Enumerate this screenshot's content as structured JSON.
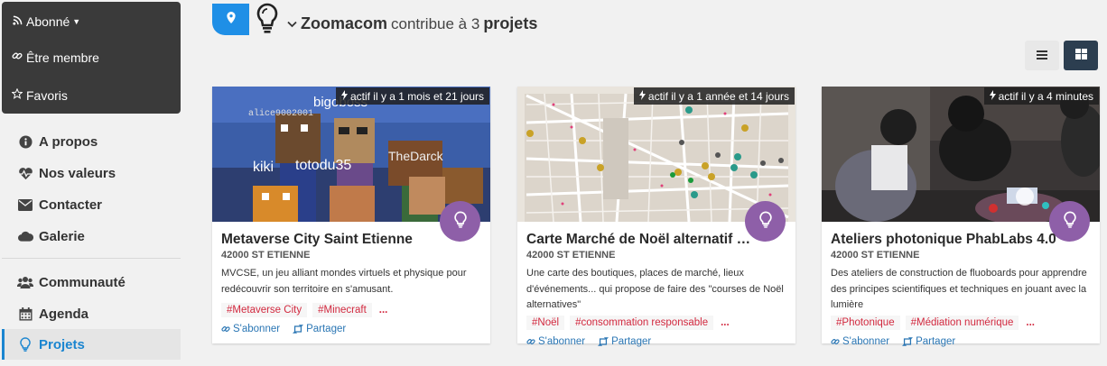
{
  "sidebar": {
    "subscribe_label": "Abonné",
    "member_label": "Être membre",
    "favorites_label": "Favoris",
    "nav": [
      {
        "label": "A propos",
        "icon": "info-circle-icon"
      },
      {
        "label": "Nos valeurs",
        "icon": "heartbeat-icon"
      },
      {
        "label": "Contacter",
        "icon": "envelope-icon"
      },
      {
        "label": "Galerie",
        "icon": "cloud-icon"
      },
      {
        "label": "Communauté",
        "icon": "users-icon"
      },
      {
        "label": "Agenda",
        "icon": "calendar-icon"
      },
      {
        "label": "Projets",
        "icon": "lightbulb-icon"
      }
    ],
    "active": "Projets"
  },
  "header": {
    "org": "Zoomacom",
    "middle": "contribue à 3",
    "suffix": "projets"
  },
  "colors": {
    "accent": "#1a85d0",
    "badge_blue": "#1f8fe6",
    "purple": "#8e5fa8",
    "tag_red": "#d2293f",
    "dark_button": "#2c3e50"
  },
  "cards": [
    {
      "active": "actif il y a 1 mois et 21 jours",
      "title": "Metaverse City Saint Etienne",
      "city": "42000 ST ETIENNE",
      "description": "MVCSE, un jeu alliant mondes virtuels et physique pour redécouvrir son territoire en s'amusant.",
      "tags": [
        "#Metaverse City",
        "#Minecraft"
      ],
      "more": "...",
      "image_text": [
        "bigoboss",
        "alice9002001",
        "kiki",
        "totodu35",
        "TheDarck"
      ],
      "subscribe": "S'abonner",
      "share": "Partager"
    },
    {
      "active": "actif il y a 1 année et 14 jours",
      "title": "Carte Marché de Noël alternatif Saint-Etienne",
      "city": "42000 ST ETIENNE",
      "description": "Une carte des boutiques, places de marché, lieux d'événements... qui propose de faire des \"courses de Noël alternatives\"",
      "tags": [
        "#Noël",
        "#consommation responsable"
      ],
      "more": "...",
      "subscribe": "S'abonner",
      "share": "Partager"
    },
    {
      "active": "actif il y a 4 minutes",
      "title": "Ateliers photonique PhabLabs 4.0",
      "city": "42000 ST ETIENNE",
      "description": "Des ateliers de construction de fluoboards pour apprendre des principes scientifiques et techniques en jouant avec la lumière",
      "tags": [
        "#Photonique",
        "#Médiation numérique"
      ],
      "more": "...",
      "subscribe": "S'abonner",
      "share": "Partager"
    }
  ]
}
